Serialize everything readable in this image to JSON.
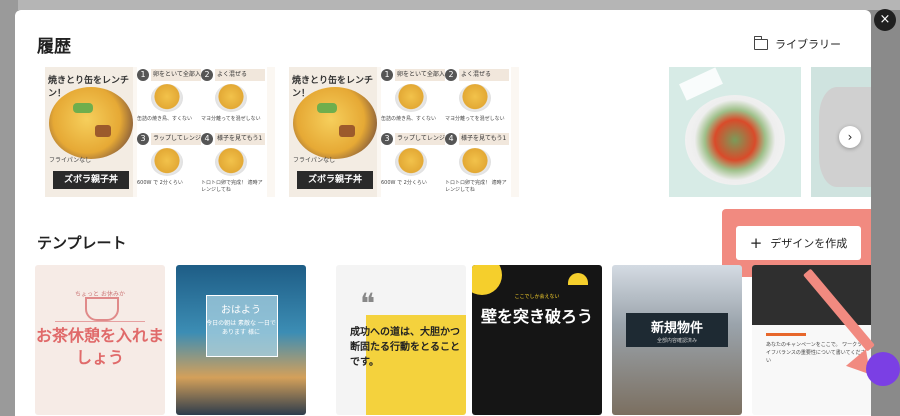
{
  "close": {
    "glyph": "×"
  },
  "history": {
    "title": "履歴",
    "library_label": "ライブラリー",
    "recipe_card": {
      "headline": "焼きとり缶をレンチン！",
      "tag": "ズボラ親子丼",
      "mini": "フライパンなし"
    },
    "steps": [
      {
        "num": "1",
        "label": "卵をといて全部入れる",
        "caption": "缶詰の焼き鳥、すくない"
      },
      {
        "num": "2",
        "label": "よく混ぜる",
        "caption": "マヨ分離ってを混ぜしない"
      },
      {
        "num": "3",
        "label": "ラップしてレンジでチン",
        "caption": "600W で 2分くらい"
      },
      {
        "num": "4",
        "label": "様子を見てもう1回チン",
        "caption": "トロトロ卵で完成！ 適時アレンジしてね"
      }
    ],
    "next_glyph": "›"
  },
  "templates": {
    "title": "テンプレート",
    "create_label": "デザインを作成",
    "plus_glyph": "+",
    "items": [
      {
        "small": "ちょっと お休みか",
        "big": "お茶休憩を入れましょう"
      },
      {
        "greet": "おはよう",
        "sub": "今日の朝は 素敵な 一日であります 様に"
      },
      {
        "quote": "❝",
        "text": "成功への道は、大胆かつ断固たる行動をとることです。"
      },
      {
        "small": "ここでしか会えない",
        "big": "壁を突き破ろう"
      },
      {
        "big": "新規物件",
        "small": "全部内容確認済み"
      },
      {
        "text": "あなたのキャンペーンをここで。 ワークライフバランスの重要性について書いてください"
      }
    ]
  }
}
